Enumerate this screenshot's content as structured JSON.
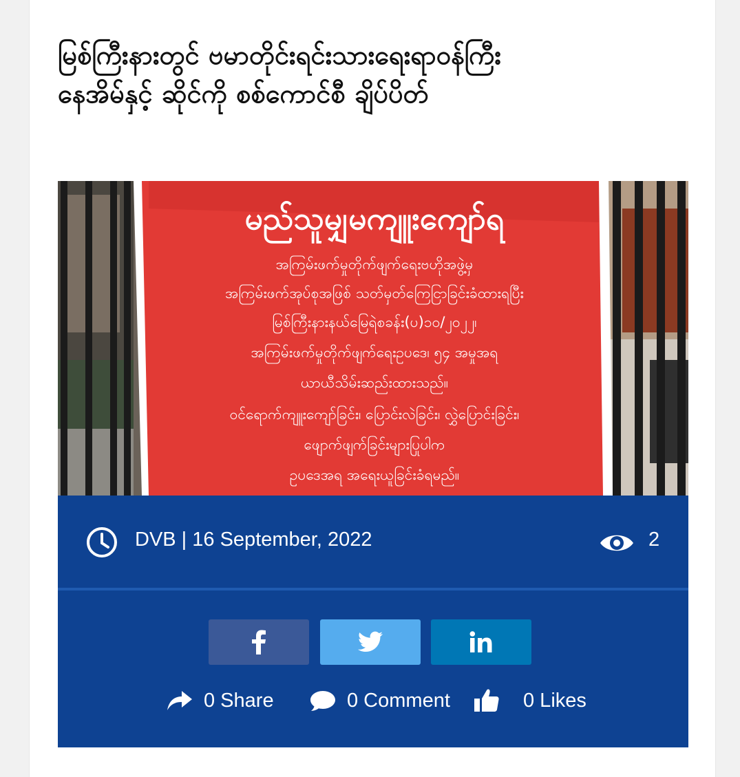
{
  "article": {
    "title_line1": "မြစ်ကြီးနားတွင် ဗမာတိုင်းရင်းသားရေးရာဝန်ကြီး",
    "title_line2": "နေအိမ်နှင့် ဆိုင်ကို စစ်ကောင်စီ ချိပ်ပိတ်"
  },
  "banner": {
    "heading": "မည်သူမျှမကျူးကျော်ရ",
    "lines": [
      "အကြမ်းဖက်မှုတိုက်ဖျက်ရေးဗဟိုအဖွဲ့မှ",
      "အကြမ်းဖက်အုပ်စုအဖြစ် သတ်မှတ်ကြေငြာခြင်းခံထားရပြီး",
      "မြစ်ကြီးနားနယ်မြေရဲစခန်း(ပ)၁၀/၂၀၂၂၊",
      "အကြမ်းဖက်မှုတိုက်ဖျက်ရေးဥပဒေ၊ ၅၄ အမှုအရ",
      "ယာယီသိမ်းဆည်းထားသည်။",
      "ဝင်ရောက်ကျူးကျော်ခြင်း၊ ပြောင်းလဲခြင်း၊ လွှဲပြောင်းခြင်း၊",
      "ဖျောက်ဖျက်ခြင်းများပြုပါက",
      "ဥပဒေအရ အရေးယူခြင်းခံရမည်။"
    ]
  },
  "meta": {
    "byline": "DVB | 16 September, 2022",
    "views": "2",
    "icons": {
      "time": "clock-icon",
      "views": "eye-icon"
    }
  },
  "social": {
    "buttons": [
      {
        "label": "f",
        "network": "facebook",
        "color": "#3b5998"
      },
      {
        "label": "twitter",
        "network": "twitter",
        "color": "#55acee"
      },
      {
        "label": "in",
        "network": "linkedin",
        "color": "#0077b5"
      }
    ],
    "share_text": "0 Share",
    "comment_text": "0 Comment",
    "likes_text": "0 Likes"
  },
  "colors": {
    "meta_bar": "#0e4292",
    "banner_red": "#e23a35"
  }
}
